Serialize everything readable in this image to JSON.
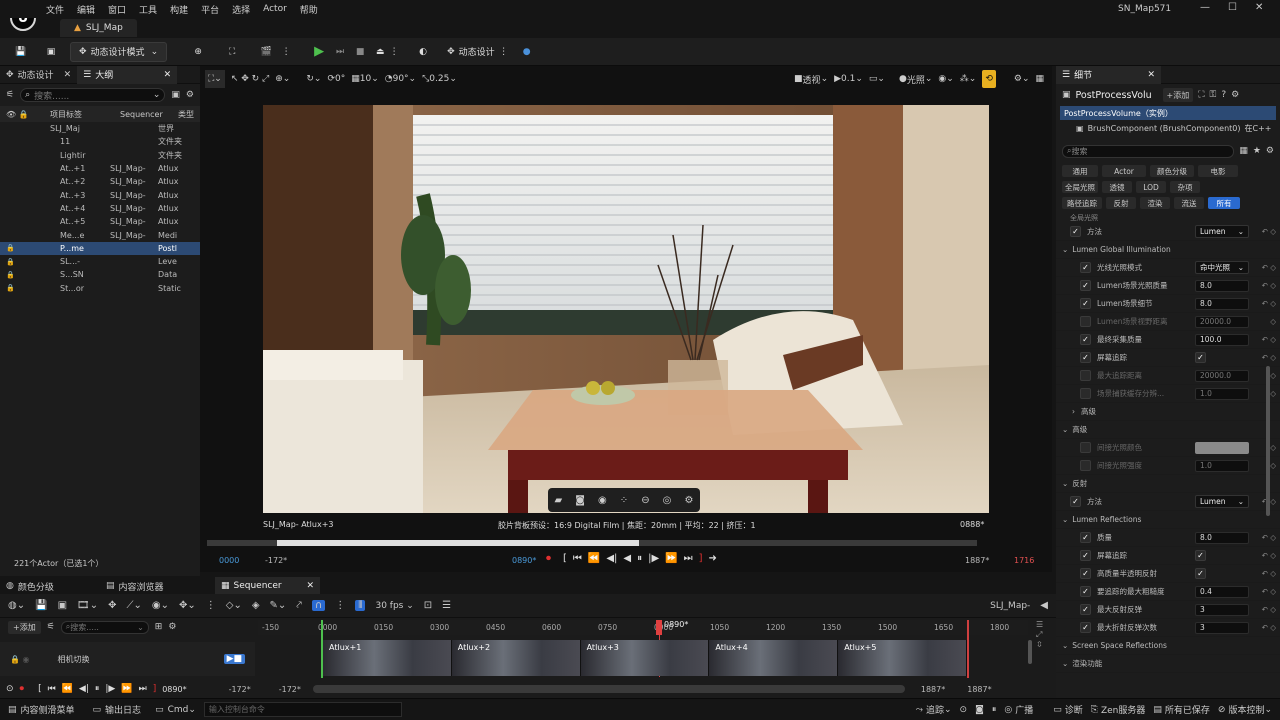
{
  "window": {
    "title": "SN_Map571",
    "tab": "SLJ_Map",
    "logo": "U"
  },
  "menu": [
    "文件",
    "编辑",
    "窗口",
    "工具",
    "构建",
    "平台",
    "选择",
    "Actor",
    "帮助"
  ],
  "toolbar": {
    "mode": "动态设计模式",
    "dyn": "动态设计"
  },
  "left": {
    "tab1": "动态设计",
    "tab2": "大纲",
    "search": "搜索......",
    "col1": "项目标签",
    "col2": "Sequencer",
    "col3": "类型",
    "rows": [
      {
        "name": "SLJ_Maj",
        "src": "",
        "type": "世界",
        "sel": false,
        "indent": 1
      },
      {
        "name": "11",
        "src": "",
        "type": "文件夹",
        "sel": false,
        "indent": 2
      },
      {
        "name": "Lightir",
        "src": "",
        "type": "文件夹",
        "sel": false,
        "indent": 2
      },
      {
        "name": "At..+1",
        "src": "SLJ_Map-",
        "type": "Atlux",
        "sel": false,
        "indent": 2
      },
      {
        "name": "At..+2",
        "src": "SLJ_Map-",
        "type": "Atlux",
        "sel": false,
        "indent": 2
      },
      {
        "name": "At..+3",
        "src": "SLJ_Map-",
        "type": "Atlux",
        "sel": false,
        "indent": 2
      },
      {
        "name": "At..+4",
        "src": "SLJ_Map-",
        "type": "Atlux",
        "sel": false,
        "indent": 2
      },
      {
        "name": "At..+5",
        "src": "SLJ_Map-",
        "type": "Atlux",
        "sel": false,
        "indent": 2
      },
      {
        "name": "Me...e",
        "src": "SLJ_Map-",
        "type": "Medi",
        "sel": false,
        "indent": 2
      },
      {
        "name": "P...me",
        "src": "",
        "type": "Postl",
        "sel": true,
        "indent": 2
      },
      {
        "name": "SL...-",
        "src": "",
        "type": "Leve",
        "sel": false,
        "indent": 2
      },
      {
        "name": "S...SN",
        "src": "",
        "type": "Data",
        "sel": false,
        "indent": 2
      },
      {
        "name": "St...or",
        "src": "",
        "type": "Static",
        "sel": false,
        "indent": 2
      }
    ],
    "count": "221个Actor（已选1个）"
  },
  "viewport": {
    "view": "透视",
    "light": "光照",
    "snap1": "0°",
    "snap2": "10",
    "angle": "90°",
    "scale": "0.25",
    "speed": "0.1",
    "cam_label": "SLJ_Map- Atlux+3",
    "film": "胶片背板预设：16:9 Digital Film | 焦距：20mm | 平均：22 | 挤压：1",
    "frame": "0888*"
  },
  "timeline_top": {
    "start": "0000",
    "neg": "-172*",
    "cur": "0890*",
    "end": "1887*",
    "end2": "1716"
  },
  "bottom_tabs": {
    "t1": "颜色分级",
    "t2": "内容浏览器",
    "t3": "Sequencer"
  },
  "seq": {
    "fps": "30 fps",
    "map": "SLJ_Map-",
    "add": "+添加",
    "search": "搜索.....",
    "track": "相机切换",
    "cursor": "0890*",
    "ticks": [
      "-150",
      "0000",
      "0150",
      "0300",
      "0450",
      "0600",
      "0750",
      "0900",
      "1050",
      "1200",
      "1350",
      "1500",
      "1650",
      "1800"
    ],
    "clips": [
      "Atlux+1",
      "Atlux+2",
      "Atlux+3",
      "Atlux+4",
      "Atlux+5"
    ],
    "bottom": {
      "cur": "0890*",
      "n1": "-172*",
      "n2": "-172*",
      "e1": "1887*",
      "e2": "1887*"
    }
  },
  "details": {
    "tab": "细节",
    "name": "PostProcessVolu",
    "add": "+添加",
    "inst": "PostProcessVolume（实例）",
    "comp": "BrushComponent (BrushComponent0)",
    "comp_r": "在C++",
    "search": "搜索",
    "filters1": [
      "通用",
      "Actor",
      "颜色分级",
      "电影"
    ],
    "filters2": [
      "全局光照",
      "透镜",
      "LOD",
      "杂项"
    ],
    "filters3": [
      "路径追踪",
      "反射",
      "渲染",
      "流送",
      "所有"
    ],
    "partial": "全局光照",
    "rows": [
      {
        "kind": "prop",
        "label": "方法",
        "val": "Lumen",
        "type": "dd",
        "cb": true,
        "ind": 1
      },
      {
        "kind": "sec",
        "label": "Lumen Global Illumination"
      },
      {
        "kind": "prop",
        "label": "光线光照模式",
        "val": "命中光照",
        "type": "dd",
        "cb": true,
        "ind": 2
      },
      {
        "kind": "prop",
        "label": "Lumen场景光照质量",
        "val": "8.0",
        "type": "num",
        "cb": true,
        "ind": 2
      },
      {
        "kind": "prop",
        "label": "Lumen场景细节",
        "val": "8.0",
        "type": "num",
        "cb": true,
        "ind": 2
      },
      {
        "kind": "prop",
        "label": "Lumen场景视野距离",
        "val": "20000.0",
        "type": "num",
        "cb": false,
        "ind": 2,
        "dim": true
      },
      {
        "kind": "prop",
        "label": "最终采集质量",
        "val": "100.0",
        "type": "num",
        "cb": true,
        "ind": 2
      },
      {
        "kind": "prop",
        "label": "屏幕追踪",
        "val": "✓",
        "type": "chk",
        "cb": true,
        "ind": 2
      },
      {
        "kind": "prop",
        "label": "最大追踪距离",
        "val": "20000.0",
        "type": "num",
        "cb": false,
        "ind": 2,
        "dim": true
      },
      {
        "kind": "prop",
        "label": "场景捕获缓存分辨...",
        "val": "1.0",
        "type": "num",
        "cb": false,
        "ind": 2,
        "dim": true
      },
      {
        "kind": "sub",
        "label": "高级"
      },
      {
        "kind": "sec",
        "label": "高级"
      },
      {
        "kind": "prop",
        "label": "间接光照颜色",
        "val": "",
        "type": "color",
        "cb": false,
        "ind": 2,
        "dim": true
      },
      {
        "kind": "prop",
        "label": "间接光照强度",
        "val": "1.0",
        "type": "num",
        "cb": false,
        "ind": 2,
        "dim": true
      },
      {
        "kind": "sec",
        "label": "反射"
      },
      {
        "kind": "prop",
        "label": "方法",
        "val": "Lumen",
        "type": "dd",
        "cb": true,
        "ind": 1
      },
      {
        "kind": "sec",
        "label": "Lumen Reflections"
      },
      {
        "kind": "prop",
        "label": "质量",
        "val": "8.0",
        "type": "num",
        "cb": true,
        "ind": 2
      },
      {
        "kind": "prop",
        "label": "屏幕追踪",
        "val": "✓",
        "type": "chk",
        "cb": true,
        "ind": 2
      },
      {
        "kind": "prop",
        "label": "高质量半透明反射",
        "val": "✓",
        "type": "chk",
        "cb": true,
        "ind": 2
      },
      {
        "kind": "prop",
        "label": "要追踪的最大粗糙度",
        "val": "0.4",
        "type": "num",
        "cb": true,
        "ind": 2
      },
      {
        "kind": "prop",
        "label": "最大反射反弹",
        "val": "3",
        "type": "num",
        "cb": true,
        "ind": 2
      },
      {
        "kind": "prop",
        "label": "最大折射反弹次数",
        "val": "3",
        "type": "num",
        "cb": true,
        "ind": 2
      },
      {
        "kind": "sec",
        "label": "Screen Space Reflections"
      },
      {
        "kind": "sec",
        "label": "渲染功能"
      }
    ]
  },
  "status": {
    "drawer": "内容侧滑菜单",
    "log": "输出日志",
    "cmd": "Cmd",
    "cmd_ph": "输入控制台命令",
    "track": "追踪",
    "broadcast": "广播",
    "diag": "诊断",
    "zen": "Zen服务器",
    "saved": "所有已保存",
    "vc": "版本控制"
  }
}
